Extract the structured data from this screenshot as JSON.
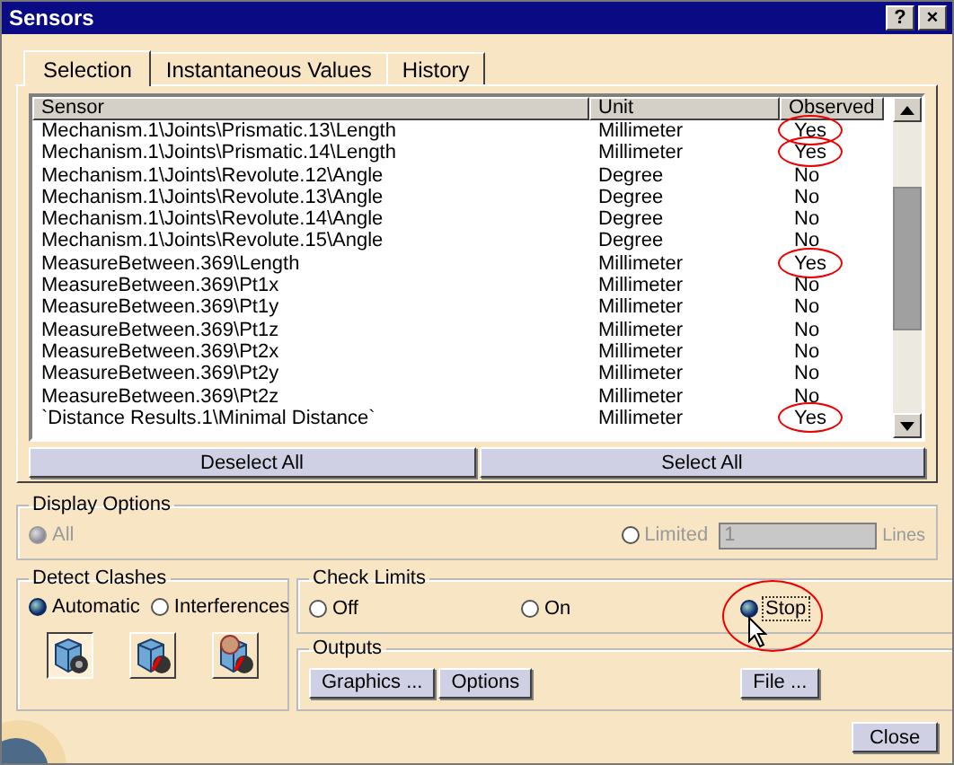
{
  "window": {
    "title": "Sensors",
    "help_button": "?",
    "close_button": "×"
  },
  "tabs": [
    {
      "label": "Selection",
      "selected": true
    },
    {
      "label": "Instantaneous Values",
      "selected": false
    },
    {
      "label": "History",
      "selected": false
    }
  ],
  "table": {
    "columns": [
      "Sensor",
      "Unit",
      "Observed"
    ],
    "rows": [
      {
        "sensor": "Mechanism.1\\Joints\\Prismatic.13\\Length",
        "unit": "Millimeter",
        "observed": "Yes",
        "circled": true
      },
      {
        "sensor": "Mechanism.1\\Joints\\Prismatic.14\\Length",
        "unit": "Millimeter",
        "observed": "Yes",
        "circled": true
      },
      {
        "sensor": "Mechanism.1\\Joints\\Revolute.12\\Angle",
        "unit": "Degree",
        "observed": "No",
        "circled": false
      },
      {
        "sensor": "Mechanism.1\\Joints\\Revolute.13\\Angle",
        "unit": "Degree",
        "observed": "No",
        "circled": false
      },
      {
        "sensor": "Mechanism.1\\Joints\\Revolute.14\\Angle",
        "unit": "Degree",
        "observed": "No",
        "circled": false
      },
      {
        "sensor": "Mechanism.1\\Joints\\Revolute.15\\Angle",
        "unit": "Degree",
        "observed": "No",
        "circled": false
      },
      {
        "sensor": "MeasureBetween.369\\Length",
        "unit": "Millimeter",
        "observed": "Yes",
        "circled": true
      },
      {
        "sensor": "MeasureBetween.369\\Pt1x",
        "unit": "Millimeter",
        "observed": "No",
        "circled": false
      },
      {
        "sensor": "MeasureBetween.369\\Pt1y",
        "unit": "Millimeter",
        "observed": "No",
        "circled": false
      },
      {
        "sensor": "MeasureBetween.369\\Pt1z",
        "unit": "Millimeter",
        "observed": "No",
        "circled": false
      },
      {
        "sensor": "MeasureBetween.369\\Pt2x",
        "unit": "Millimeter",
        "observed": "No",
        "circled": false
      },
      {
        "sensor": "MeasureBetween.369\\Pt2y",
        "unit": "Millimeter",
        "observed": "No",
        "circled": false
      },
      {
        "sensor": "MeasureBetween.369\\Pt2z",
        "unit": "Millimeter",
        "observed": "No",
        "circled": false
      },
      {
        "sensor": "`Distance Results.1\\Minimal Distance`",
        "unit": "Millimeter",
        "observed": "Yes",
        "circled": true
      }
    ]
  },
  "table_buttons": [
    "Deselect All",
    "Select All"
  ],
  "display_options": {
    "title": "Display Options",
    "options": [
      {
        "label": "All",
        "selected": true,
        "disabled": true
      },
      {
        "label": "Limited",
        "selected": false,
        "disabled": true
      }
    ],
    "lines_field": {
      "value": "1",
      "disabled": true
    },
    "lines_label": "Lines"
  },
  "detect_clashes": {
    "title": "Detect Clashes",
    "options": [
      {
        "label": "Automatic",
        "selected": true
      },
      {
        "label": "Interferences",
        "selected": false
      }
    ],
    "tools": [
      {
        "selected": true,
        "kind": "plain"
      },
      {
        "selected": false,
        "kind": "mark"
      },
      {
        "selected": false,
        "kind": "stop"
      }
    ]
  },
  "check_limits": {
    "title": "Check Limits",
    "options": [
      {
        "label": "Off",
        "selected": false,
        "circled": false
      },
      {
        "label": "On",
        "selected": false,
        "circled": false
      },
      {
        "label": "Stop",
        "selected": true,
        "circled": true
      }
    ]
  },
  "outputs": {
    "title": "Outputs",
    "buttons": [
      "Graphics ...",
      "Options",
      "File ..."
    ]
  },
  "close_label": "Close"
}
